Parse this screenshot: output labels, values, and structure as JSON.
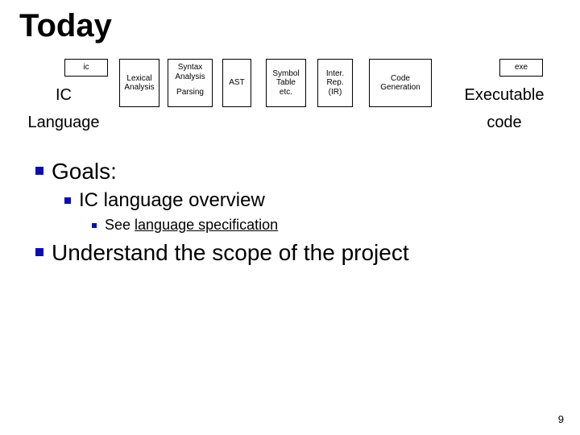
{
  "title": "Today",
  "pipeline": {
    "stages": {
      "ic": "ic",
      "lexical": "Lexical\nAnalysis",
      "syntax_top": "Syntax\nAnalysis",
      "syntax_bottom": "Parsing",
      "ast": "AST",
      "symbol": "Symbol\nTable\netc.",
      "ir": "Inter.\nRep.\n(IR)",
      "codegen": "Code\nGeneration",
      "exe": "exe"
    },
    "left_label_top": "IC",
    "left_label_bottom": "Language",
    "right_label_top": "Executable",
    "right_label_bottom": "code"
  },
  "bullets": {
    "goals": "Goals:",
    "ic_overview": "IC language overview",
    "see_prefix": "See ",
    "see_link": "language specification",
    "scope": "Understand the scope of the project"
  },
  "page_number": "9"
}
